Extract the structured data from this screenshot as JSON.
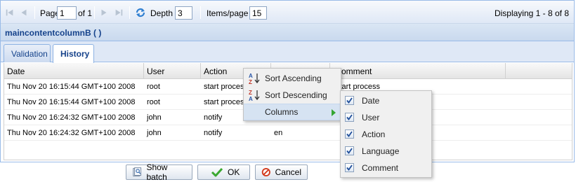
{
  "toolbar": {
    "page_label": "Page",
    "page_value": "1",
    "of_label": "of 1",
    "depth_label": "Depth",
    "depth_value": "3",
    "items_per_page_label": "Items/page",
    "items_per_page_value": "15",
    "displaying_text": "Displaying 1 - 8 of 8"
  },
  "panel": {
    "title": "maincontentcolumnB ( )"
  },
  "tabs": [
    {
      "label": "Validation",
      "active": false
    },
    {
      "label": "History",
      "active": true
    }
  ],
  "grid": {
    "columns": [
      "Date",
      "User",
      "Action",
      "Language",
      "Comment"
    ],
    "header_visible": {
      "date": "Date",
      "user": "User",
      "action": "Action",
      "comment_partial": "omment"
    },
    "rows": [
      {
        "date": "Thu Nov 20 16:15:44 GMT+100 2008",
        "user": "root",
        "action": "start process",
        "language": "",
        "comment": "start process"
      },
      {
        "date": "Thu Nov 20 16:15:44 GMT+100 2008",
        "user": "root",
        "action": "start process",
        "language": "",
        "comment": ""
      },
      {
        "date": "Thu Nov 20 16:24:32 GMT+100 2008",
        "user": "john",
        "action": "notify",
        "language": "",
        "comment": ""
      },
      {
        "date": "Thu Nov 20 16:24:32 GMT+100 2008",
        "user": "john",
        "action": "notify",
        "language": "en",
        "comment": ""
      }
    ],
    "visible_cells": {
      "r0_action": "start proces",
      "r0_comment": "start process",
      "r1_action": "start proces",
      "r3_language": "en"
    }
  },
  "context_menu": {
    "items": [
      {
        "label": "Sort Ascending",
        "icon": "sort-ascending-icon"
      },
      {
        "label": "Sort Descending",
        "icon": "sort-descending-icon"
      },
      {
        "label": "Columns",
        "icon": "submenu-arrow-icon"
      }
    ],
    "columns_submenu": [
      {
        "label": "Date",
        "checked": true
      },
      {
        "label": "User",
        "checked": true
      },
      {
        "label": "Action",
        "checked": true
      },
      {
        "label": "Language",
        "checked": true
      },
      {
        "label": "Comment",
        "checked": true
      }
    ]
  },
  "buttons": {
    "show_batch": "Show batch",
    "ok": "OK",
    "cancel": "Cancel"
  },
  "colors": {
    "panel_border": "#99bbe8",
    "header_text": "#15428b",
    "refresh_blue": "#2f7fd1",
    "ok_green": "#3aa830",
    "cancel_red": "#d33a1c",
    "menu_arrow_green": "#35a531"
  }
}
